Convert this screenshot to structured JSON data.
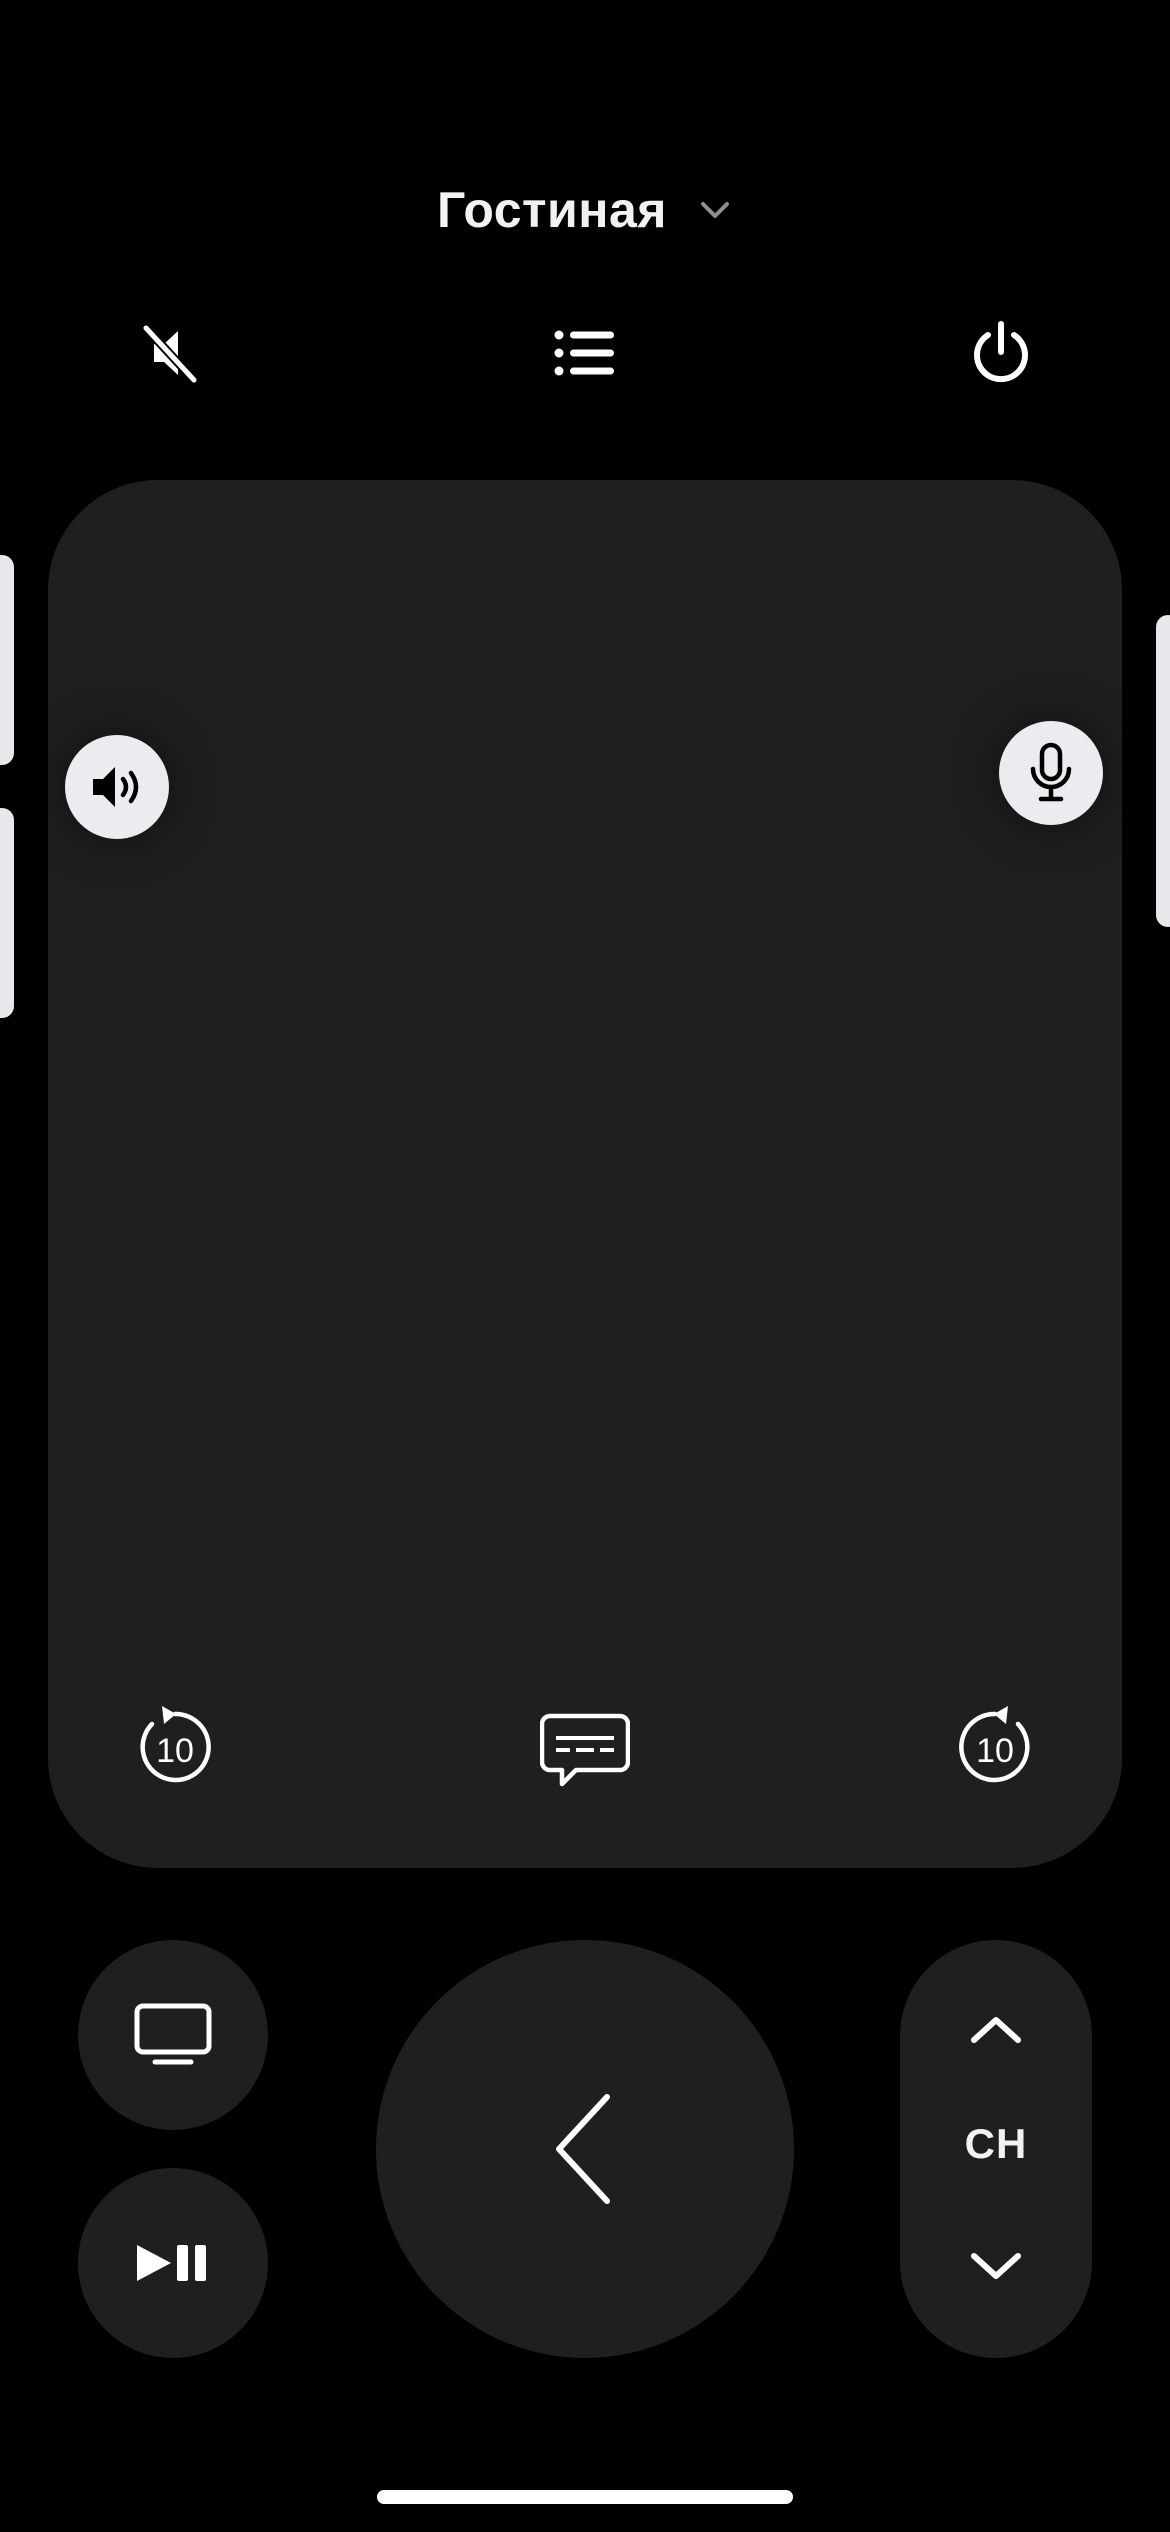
{
  "header": {
    "title": "Гостиная",
    "dropdown_icon": "chevron-down-icon"
  },
  "toolbar": {
    "mute_icon": "speaker-slash-icon",
    "list_icon": "list-icon",
    "power_icon": "power-icon"
  },
  "trackpad": {
    "volume_icon": "speaker-wave-icon",
    "mic_icon": "microphone-icon",
    "skip_back": "10",
    "skip_forward": "10",
    "captions_icon": "captions-bubble-icon"
  },
  "controls": {
    "tv_icon": "tv-icon",
    "play_pause_icon": "play-pause-icon",
    "back_icon": "chevron-left-icon",
    "channel_label": "CH",
    "channel_up_icon": "chevron-up-icon",
    "channel_down_icon": "chevron-down-icon"
  },
  "colors": {
    "background": "#000000",
    "panel": "#1f1f20",
    "foreground": "#ffffff",
    "float_button": "#ebebf0"
  }
}
